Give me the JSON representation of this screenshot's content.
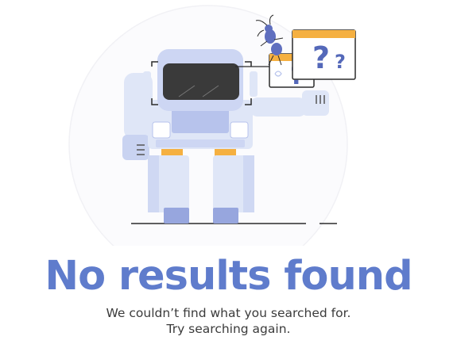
{
  "empty_state": {
    "title": "No results found",
    "message_line1": "We couldn’t find what you searched for.",
    "message_line2": "Try searching again."
  },
  "illustration": {
    "question_mark": "?"
  },
  "colors": {
    "title": "#5f7ccc",
    "robot_body": "#dfe6f7",
    "robot_accent": "#b7c3ec",
    "robot_dark": "#97a6de",
    "visor": "#3a3a3a",
    "orange": "#f5b041",
    "question": "#5468b9",
    "text": "#3b3b3b"
  },
  "icons": [
    "robot-illustration",
    "ant-icon",
    "question-window-icon"
  ]
}
